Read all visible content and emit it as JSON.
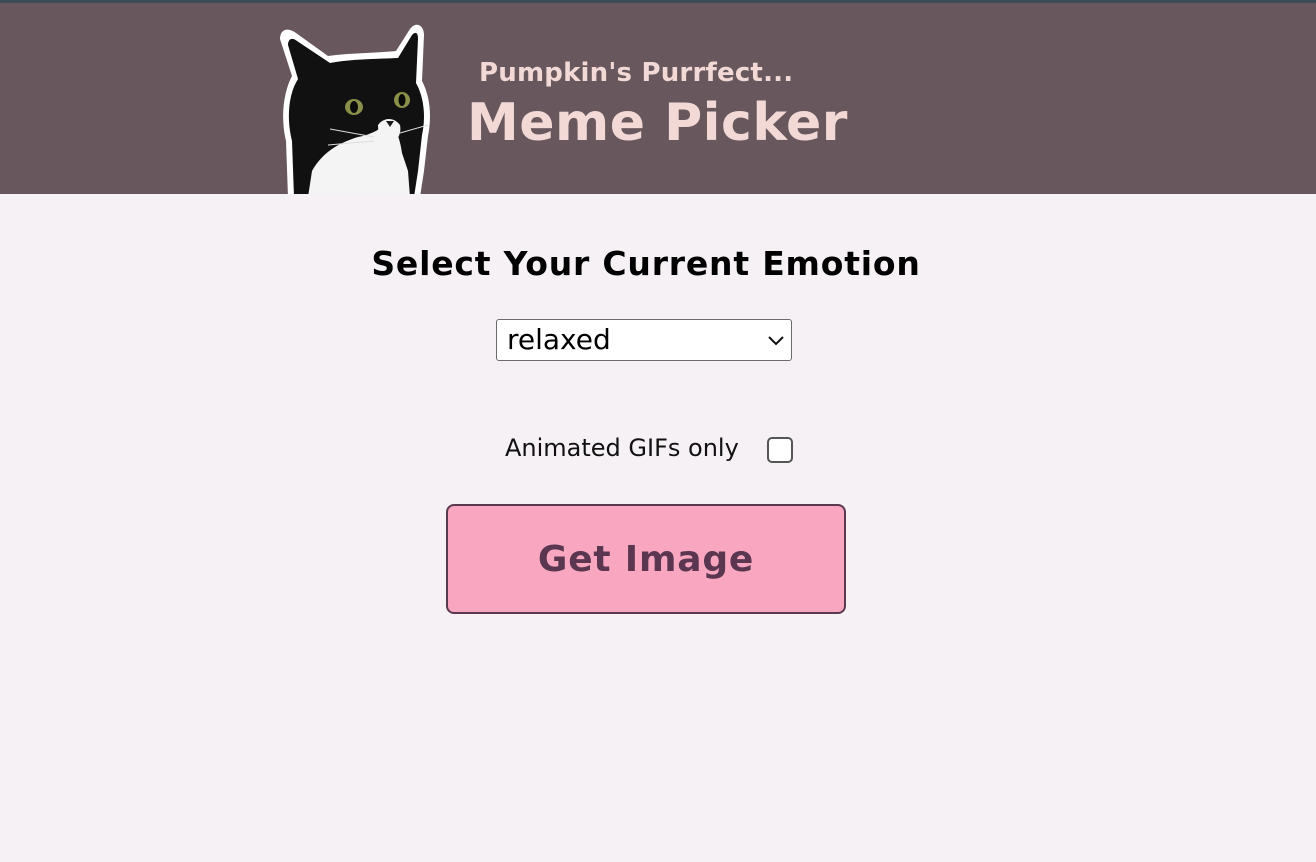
{
  "header": {
    "subtitle": "Pumpkin's Purrfect...",
    "title": "Meme Picker",
    "logo_icon": "tuxedo-cat-logo"
  },
  "emotion": {
    "heading": "Select Your Current Emotion",
    "selected": "relaxed",
    "dropdown_icon": "chevron-down-icon"
  },
  "gifs": {
    "label": "Animated GIFs only",
    "checked": false
  },
  "action": {
    "button_label": "Get Image"
  },
  "colors": {
    "header_bg": "#68585d",
    "header_text": "#f2d9d6",
    "page_bg": "#f6f1f5",
    "button_bg": "#f9a7c0",
    "button_text": "#5a3650"
  }
}
